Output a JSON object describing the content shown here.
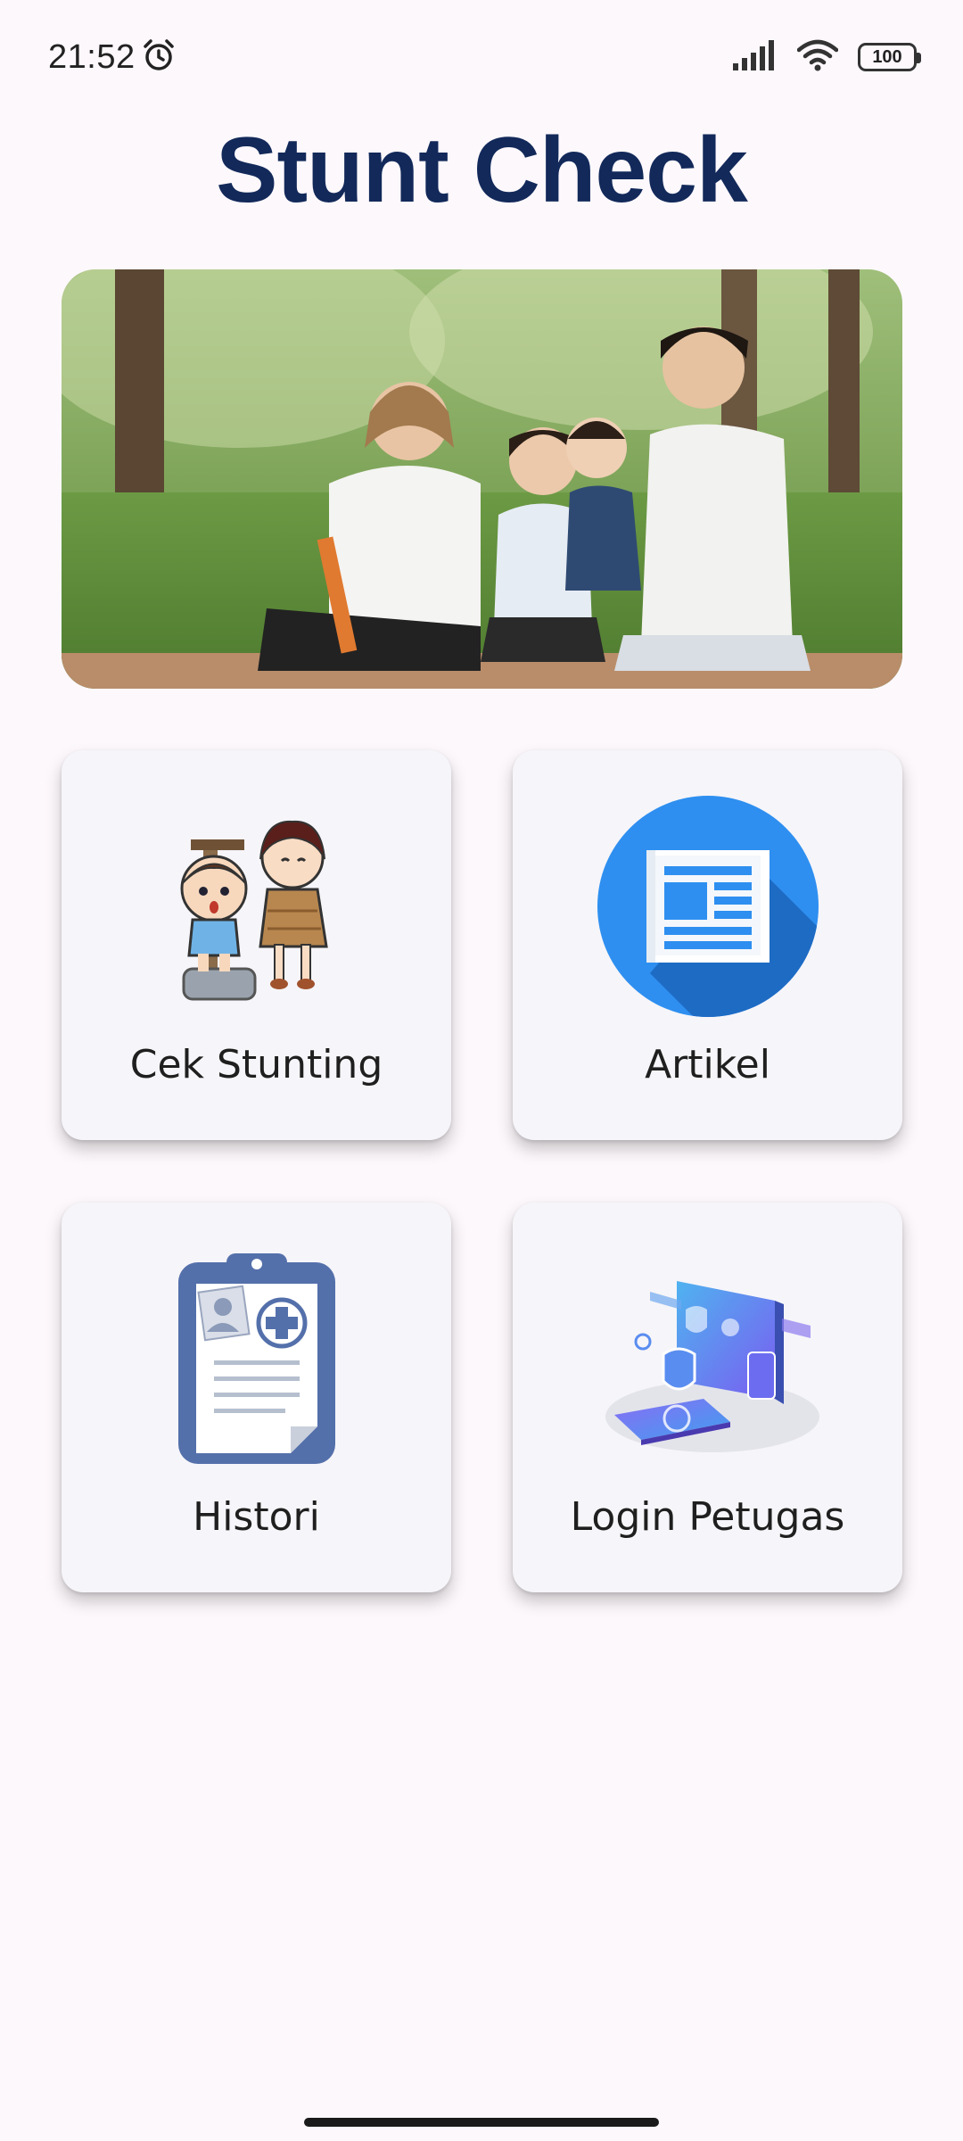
{
  "status_bar": {
    "time": "21:52",
    "battery": "100",
    "icons": [
      "alarm-icon",
      "signal-icon",
      "wifi-icon",
      "battery-icon"
    ]
  },
  "app": {
    "title": "Stunt Check"
  },
  "menu": {
    "cek_stunting": {
      "label": "Cek Stunting",
      "icon": "child-measuring-icon"
    },
    "artikel": {
      "label": "Artikel",
      "icon": "newspaper-icon"
    },
    "histori": {
      "label": "Histori",
      "icon": "medical-clipboard-icon"
    },
    "login_petugas": {
      "label": "Login Petugas",
      "icon": "security-login-icon"
    }
  },
  "colors": {
    "title": "#12295a",
    "background": "#fdf8fc",
    "card": "#f6f5f9",
    "article_blue": "#2e8ff0",
    "clipboard_blue": "#5470ab"
  }
}
